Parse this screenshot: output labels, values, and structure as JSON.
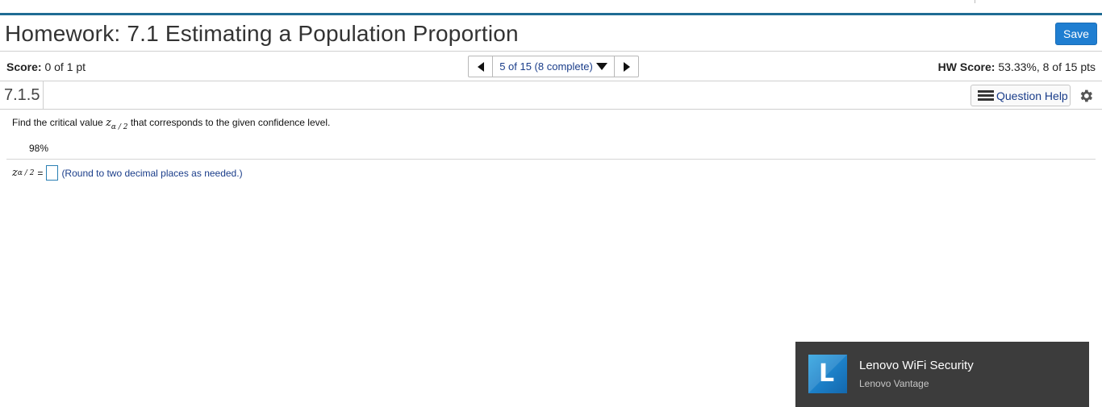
{
  "header": {
    "title": "Homework: 7.1 Estimating a Population Proportion",
    "save_label": "Save"
  },
  "score_bar": {
    "score_label": "Score:",
    "score_value": "0 of 1 pt",
    "nav_label": "5 of 15 (8 complete)",
    "hw_score_label": "HW Score:",
    "hw_score_value": "53.33%, 8 of 15 pts"
  },
  "question": {
    "number": "7.1.5",
    "help_label": "Question Help",
    "prompt_before": "Find the critical value",
    "z_symbol": "z",
    "subscript": "α / 2",
    "prompt_after": "that corresponds to the given confidence level.",
    "confidence_level": "98%",
    "answer_prefix_z": "z",
    "answer_subscript": "α / 2",
    "answer_equals": "=",
    "answer_value": "",
    "hint": "(Round to two decimal places as needed.)"
  },
  "notification": {
    "logo_letter": "L",
    "title": "Lenovo WiFi Security",
    "subtitle": "Lenovo Vantage"
  },
  "colors": {
    "accent_rule": "#1f6c94",
    "save_button": "#1f7ed1",
    "link_blue": "#1a3d8a",
    "toast_bg": "#3c3c3c"
  },
  "icons": [
    "prev-arrow-icon",
    "dropdown-caret-icon",
    "next-arrow-icon",
    "list-icon",
    "gear-icon",
    "lenovo-logo-icon"
  ]
}
